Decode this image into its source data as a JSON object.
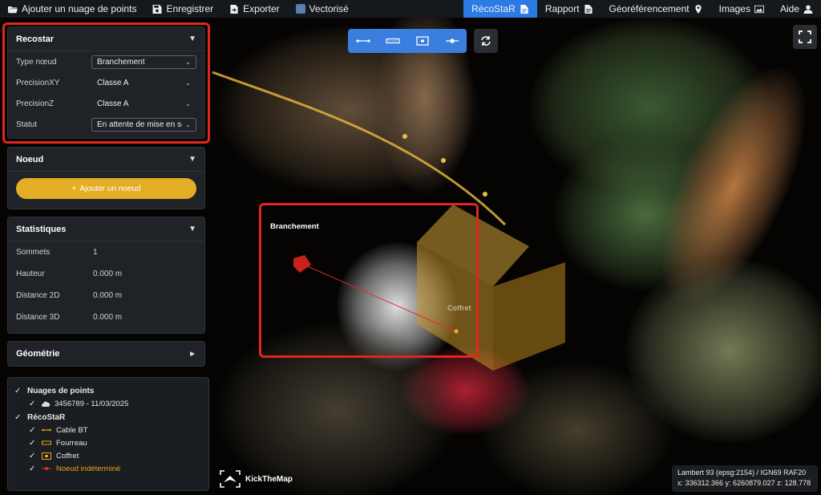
{
  "topbar": {
    "left": [
      {
        "label": "Ajouter un nuage de points",
        "icon": "folder-open-icon"
      },
      {
        "label": "Enregistrer",
        "icon": "save-icon"
      },
      {
        "label": "Exporter",
        "icon": "export-icon"
      },
      {
        "label": "Vectorisé",
        "icon": "vector-layer-icon"
      }
    ],
    "right": [
      {
        "label": "RécoStaR",
        "icon": "document-icon",
        "active": true
      },
      {
        "label": "Rapport",
        "icon": "document-icon"
      },
      {
        "label": "Géoréférencement",
        "icon": "map-pin-icon"
      },
      {
        "label": "Images",
        "icon": "image-icon"
      },
      {
        "label": "Aide",
        "icon": "user-help-icon"
      }
    ]
  },
  "panel": {
    "recostar": {
      "title": "Recostar",
      "fields": [
        {
          "label": "Type nœud",
          "value": "Branchement"
        },
        {
          "label": "PrecisionXY",
          "value": "Classe A"
        },
        {
          "label": "PrecisionZ",
          "value": "Classe A"
        },
        {
          "label": "Statut",
          "value": "En attente de mise en service"
        }
      ]
    },
    "noeud": {
      "title": "Noeud",
      "add_label": "Ajouter un noeud"
    },
    "stats": {
      "title": "Statistiques",
      "rows": [
        {
          "label": "Sommets",
          "value": "1"
        },
        {
          "label": "Hauteur",
          "value": "0.000 m"
        },
        {
          "label": "Distance 2D",
          "value": "0.000 m"
        },
        {
          "label": "Distance 3D",
          "value": "0.000 m"
        }
      ]
    },
    "geometrie": {
      "title": "Géométrie"
    }
  },
  "layers": {
    "group1": {
      "title": "Nuages de points",
      "items": [
        "3456789 - 11/03/2025"
      ]
    },
    "group2": {
      "title": "RécoStaR",
      "items": [
        "Cable BT",
        "Fourreau",
        "Coffret",
        "Noeud indéterminé"
      ]
    }
  },
  "scene": {
    "label_branchement": "Branchement",
    "label_coffret": "Coffret"
  },
  "brand": {
    "name": "KickTheMap"
  },
  "coords": {
    "line1": "Lambert 93 (epsg:2154) / IGN69 RAF20",
    "line2": "x: 336312.366  y: 6260879.027  z: 128.778"
  },
  "colors": {
    "accent": "#2c7be5",
    "add_button": "#e3ad25",
    "highlight": "#e0261d",
    "coffret": "#d8a52a"
  }
}
